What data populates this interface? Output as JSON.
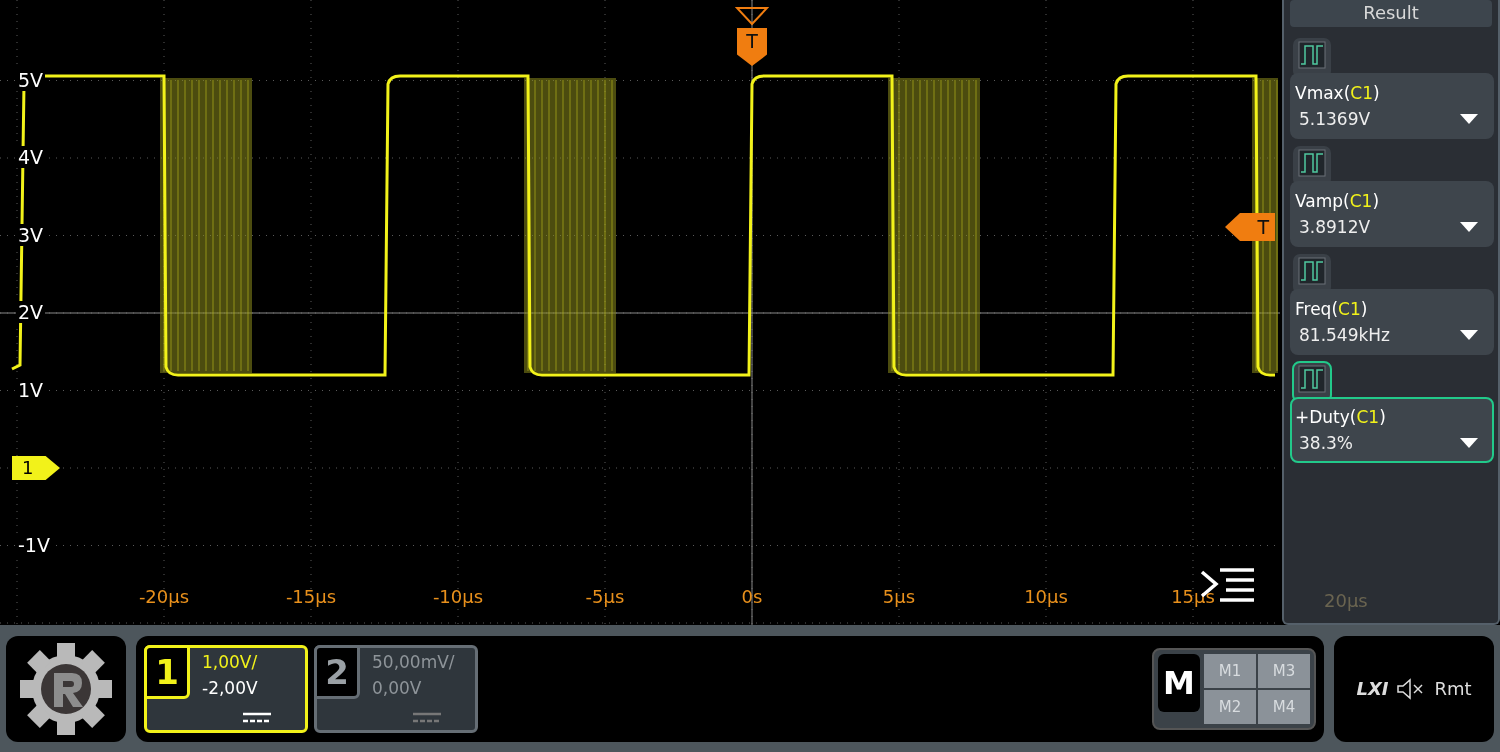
{
  "plot": {
    "y_labels": [
      "5V",
      "4V",
      "3V",
      "2V",
      "1V",
      "-1V"
    ],
    "x_labels": [
      "-20µs",
      "-15µs",
      "-10µs",
      "-5µs",
      "0s",
      "5µs",
      "10µs",
      "15µs",
      "20µs"
    ],
    "trigger_time_marker": "T",
    "trigger_level_marker": "T",
    "channel_marker": "1"
  },
  "result_panel": {
    "title": "Result",
    "measurements": [
      {
        "label_before": "Vmax(",
        "source": "C1",
        "label_after": ")",
        "value": "5.1369V",
        "selected": false
      },
      {
        "label_before": "Vamp(",
        "source": "C1",
        "label_after": ")",
        "value": "3.8912V",
        "selected": false
      },
      {
        "label_before": "Freq(",
        "source": "C1",
        "label_after": ")",
        "value": "81.549kHz",
        "selected": false
      },
      {
        "label_before": "+Duty(",
        "source": "C1",
        "label_after": ")",
        "value": "38.3%",
        "selected": true
      }
    ]
  },
  "channels": [
    {
      "number": "1",
      "scale": "1,00V/",
      "offset": "-2,00V",
      "selected": true
    },
    {
      "number": "2",
      "scale": "50,00mV/",
      "offset": "0,00V",
      "selected": false
    }
  ],
  "math": {
    "label": "M",
    "buttons": [
      "M1",
      "M3",
      "M2",
      "M4"
    ]
  },
  "status": {
    "lxi": "LXI",
    "remote": "Rmt"
  }
}
